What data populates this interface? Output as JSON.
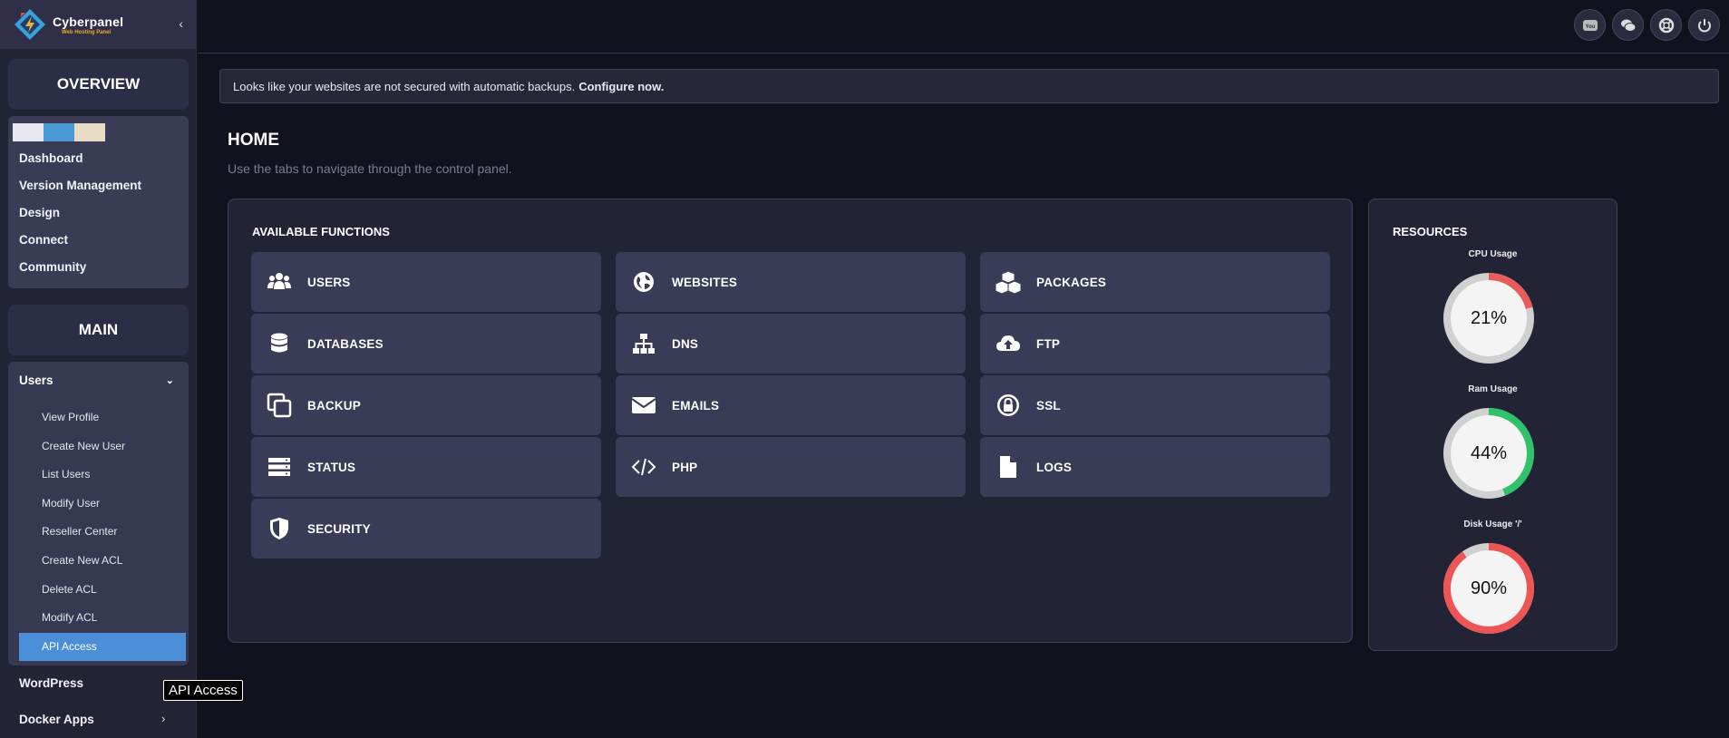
{
  "brand": {
    "name": "Cyberpanel",
    "tagline": "Web Hosting Panel"
  },
  "sidebar": {
    "overview_title": "OVERVIEW",
    "swatches": [
      "#e8e8ee",
      "#4a9ad6",
      "#e8dcc4"
    ],
    "overview_items": [
      {
        "label": "Dashboard"
      },
      {
        "label": "Version Management"
      },
      {
        "label": "Design"
      },
      {
        "label": "Connect"
      },
      {
        "label": "Community"
      }
    ],
    "main_title": "MAIN",
    "users_group": {
      "label": "Users",
      "items": [
        {
          "label": "View Profile"
        },
        {
          "label": "Create New User"
        },
        {
          "label": "List Users"
        },
        {
          "label": "Modify User"
        },
        {
          "label": "Reseller Center"
        },
        {
          "label": "Create New ACL"
        },
        {
          "label": "Delete ACL"
        },
        {
          "label": "Modify ACL"
        },
        {
          "label": "API Access"
        }
      ]
    },
    "wordpress": "WordPress",
    "docker_apps": "Docker Apps",
    "tooltip": "API Access"
  },
  "topbar": {
    "icons": [
      "youtube-icon",
      "chat-icon",
      "support-icon",
      "power-icon"
    ]
  },
  "alert": {
    "text": "Looks like your websites are not secured with automatic backups.",
    "link": "Configure now."
  },
  "home": {
    "title": "HOME",
    "subtitle": "Use the tabs to navigate through the control panel."
  },
  "functions": {
    "title": "AVAILABLE FUNCTIONS",
    "items": [
      {
        "label": "USERS",
        "icon": "users-icon"
      },
      {
        "label": "WEBSITES",
        "icon": "globe-icon"
      },
      {
        "label": "PACKAGES",
        "icon": "cubes-icon"
      },
      {
        "label": "DATABASES",
        "icon": "database-icon"
      },
      {
        "label": "DNS",
        "icon": "sitemap-icon"
      },
      {
        "label": "FTP",
        "icon": "cloud-upload-icon"
      },
      {
        "label": "BACKUP",
        "icon": "copy-icon"
      },
      {
        "label": "EMAILS",
        "icon": "envelope-icon"
      },
      {
        "label": "SSL",
        "icon": "lock-icon"
      },
      {
        "label": "STATUS",
        "icon": "server-icon"
      },
      {
        "label": "PHP",
        "icon": "code-icon"
      },
      {
        "label": "LOGS",
        "icon": "file-icon"
      },
      {
        "label": "SECURITY",
        "icon": "shield-icon"
      }
    ]
  },
  "resources": {
    "title": "RESOURCES",
    "gauges": [
      {
        "label": "CPU Usage",
        "value": "21%",
        "percent": 21,
        "color": "#e85c5c"
      },
      {
        "label": "Ram Usage",
        "value": "44%",
        "percent": 44,
        "color": "#2fc26b"
      },
      {
        "label": "Disk Usage '/'",
        "value": "90%",
        "percent": 90,
        "color": "#ee5555"
      }
    ]
  }
}
